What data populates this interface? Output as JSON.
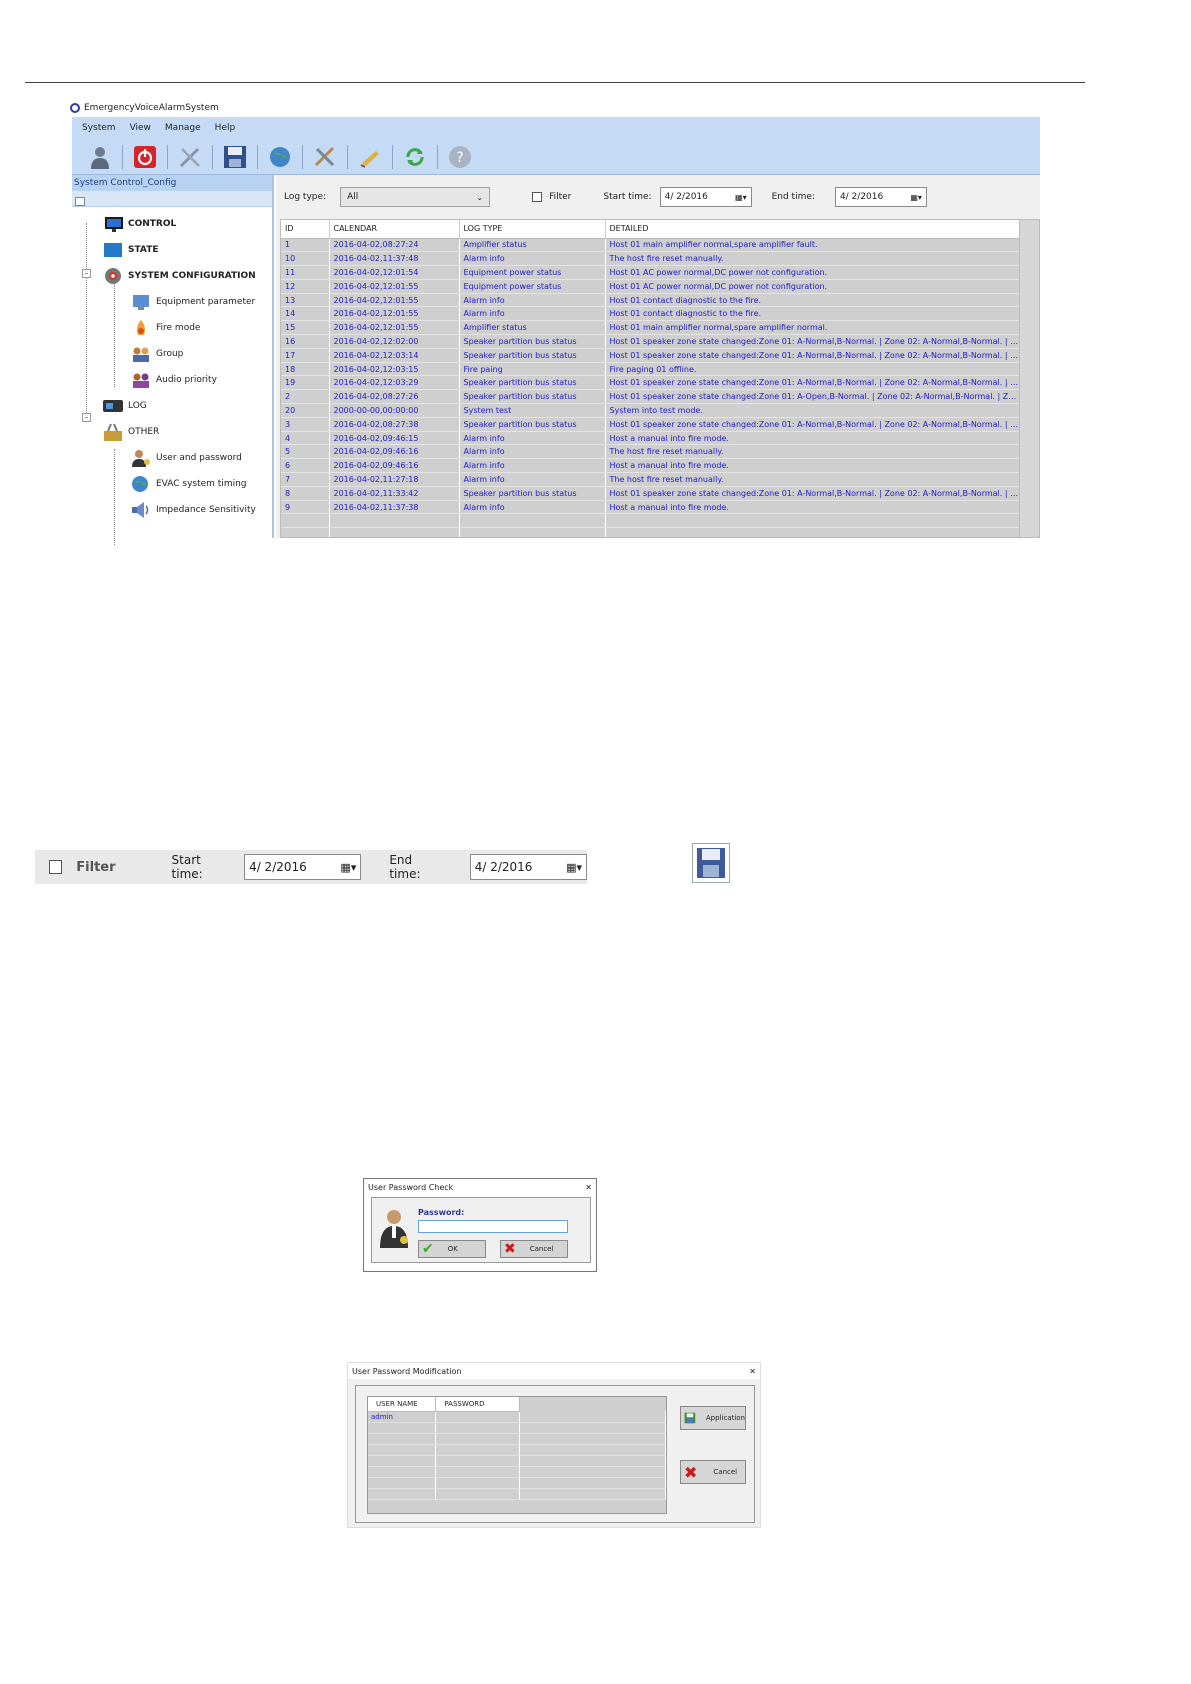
{
  "app": {
    "title": "EmergencyVoiceAlarmSystem",
    "menu": [
      "System",
      "View",
      "Manage",
      "Help"
    ],
    "panel_title": "System Control_Config"
  },
  "tree": {
    "control": "CONTROL",
    "state": "STATE",
    "system_configuration": "SYSTEM CONFIGURATION",
    "equipment_parameter": "Equipment parameter",
    "fire_mode": "Fire mode",
    "group": "Group",
    "audio_priority": "Audio priority",
    "log": "LOG",
    "other": "OTHER",
    "user_and_password": "User and password",
    "evac_system_timing": "EVAC system timing",
    "impedance_sensitivity": "Impedance Sensitivity"
  },
  "filter": {
    "log_type_label": "Log type:",
    "log_type_value": "All",
    "filter_label": "Filter",
    "start_label": "Start time:",
    "start_value": "4/  2/2016",
    "end_label": "End time:",
    "end_value": "4/  2/2016"
  },
  "log_table": {
    "headers": [
      "ID",
      "CALENDAR",
      "LOG TYPE",
      "DETAILED"
    ],
    "rows": [
      [
        "1",
        "2016-04-02,08:27:24",
        "Amplifier status",
        "Host 01 main amplifier normal,spare amplifier fault."
      ],
      [
        "10",
        "2016-04-02,11:37:48",
        "Alarm info",
        "The host fire reset manually."
      ],
      [
        "11",
        "2016-04-02,12:01:54",
        "Equipment power status",
        "Host 01 AC power normal,DC power not configuration."
      ],
      [
        "12",
        "2016-04-02,12:01:55",
        "Equipment power status",
        "Host 01 AC power normal,DC power not configuration."
      ],
      [
        "13",
        "2016-04-02,12:01:55",
        "Alarm info",
        "Host 01 contact diagnostic to the fire."
      ],
      [
        "14",
        "2016-04-02,12:01:55",
        "Alarm info",
        "Host 01 contact diagnostic to the fire."
      ],
      [
        "15",
        "2016-04-02,12:01:55",
        "Amplifier status",
        "Host 01 main amplifier normal,spare amplifier normal."
      ],
      [
        "16",
        "2016-04-02,12:02:00",
        "Speaker partition bus status",
        "Host 01 speaker zone state changed:Zone 01: A-Normal,B-Normal. | Zone 02: A-Normal,B-Normal. | Z..."
      ],
      [
        "17",
        "2016-04-02,12:03:14",
        "Speaker partition bus status",
        "Host 01 speaker zone state changed:Zone 01: A-Normal,B-Normal. | Zone 02: A-Normal,B-Normal. | Z..."
      ],
      [
        "18",
        "2016-04-02,12:03:15",
        "Fire paing",
        "Fire paging 01 offline."
      ],
      [
        "19",
        "2016-04-02,12:03:29",
        "Speaker partition bus status",
        "Host 01 speaker zone state changed:Zone 01: A-Normal,B-Normal. | Zone 02: A-Normal,B-Normal. | Z..."
      ],
      [
        "2",
        "2016-04-02,08:27:26",
        "Speaker partition bus status",
        "Host 01 speaker zone state changed:Zone 01: A-Open,B-Normal. | Zone 02: A-Normal,B-Normal. | Zo..."
      ],
      [
        "20",
        "2000-00-00,00:00:00",
        "System test",
        "System into test mode."
      ],
      [
        "3",
        "2016-04-02,08:27:38",
        "Speaker partition bus status",
        "Host 01 speaker zone state changed:Zone 01: A-Normal,B-Normal. | Zone 02: A-Normal,B-Normal. | Z..."
      ],
      [
        "4",
        "2016-04-02,09:46:15",
        "Alarm info",
        "Host a manual into fire mode."
      ],
      [
        "5",
        "2016-04-02,09:46:16",
        "Alarm info",
        "The host fire reset manually."
      ],
      [
        "6",
        "2016-04-02,09:46:16",
        "Alarm info",
        "Host a manual into fire mode."
      ],
      [
        "7",
        "2016-04-02,11:27:18",
        "Alarm info",
        "The host fire reset manually."
      ],
      [
        "8",
        "2016-04-02,11:33:42",
        "Speaker partition bus status",
        "Host 01 speaker zone state changed:Zone 01: A-Normal,B-Normal. | Zone 02: A-Normal,B-Normal. | Z..."
      ],
      [
        "9",
        "2016-04-02,11:37:38",
        "Alarm info",
        "Host a manual into fire mode."
      ]
    ]
  },
  "password_check": {
    "title": "User Password Check",
    "close": "✕",
    "password_label": "Password:",
    "ok": "OK",
    "cancel": "Cancel"
  },
  "password_mod": {
    "title": "User Password Modification",
    "close": "✕",
    "headers": [
      "USER NAME",
      "PASSWORD"
    ],
    "rows": [
      [
        "admin",
        ""
      ]
    ],
    "application": "Application",
    "cancel": "Cancel"
  },
  "colors": {
    "menubar": "#c5dbf5",
    "grid_text": "#2020c0",
    "grid_bg": "#cfcfcf"
  }
}
